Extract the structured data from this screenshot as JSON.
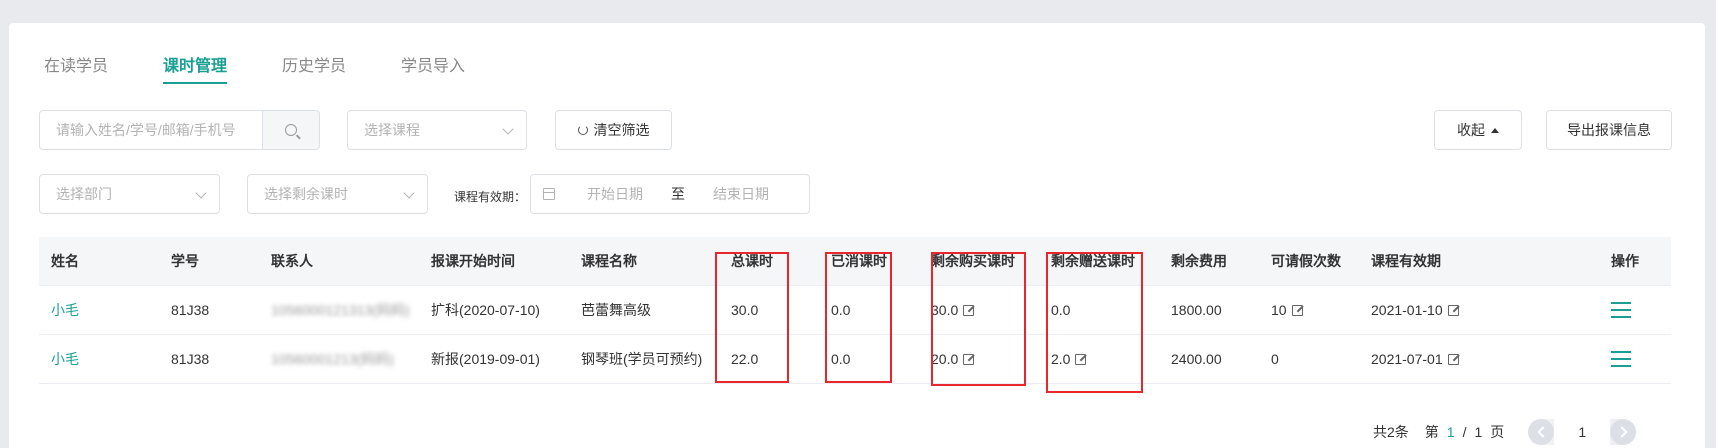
{
  "tabs": [
    {
      "label": "在读学员"
    },
    {
      "label": "课时管理"
    },
    {
      "label": "历史学员"
    },
    {
      "label": "学员导入"
    }
  ],
  "filters": {
    "search_placeholder": "请输入姓名/学号/邮箱/手机号",
    "course_placeholder": "选择课程",
    "clear_label": "清空筛选",
    "collapse_label": "收起",
    "export_label": "导出报课信息",
    "dept_placeholder": "选择部门",
    "remain_placeholder": "选择剩余课时",
    "validity_label": "课程有效期：",
    "start_date_placeholder": "开始日期",
    "date_sep": "至",
    "end_date_placeholder": "结束日期"
  },
  "table": {
    "headers": [
      "姓名",
      "学号",
      "联系人",
      "报课开始时间",
      "课程名称",
      "总课时",
      "已消课时",
      "剩余购买课时",
      "剩余赠送课时",
      "剩余费用",
      "可请假次数",
      "课程有效期",
      "操作"
    ],
    "rows": [
      {
        "name": "小毛",
        "id": "81J38",
        "contact": "1056000121313(妈妈)",
        "start": "扩科(2020-07-10)",
        "course": "芭蕾舞高级",
        "total": "30.0",
        "consumed": "0.0",
        "remain_buy": "30.0",
        "remain_gift": "0.0",
        "fee": "1800.00",
        "leave": "10",
        "validity": "2021-01-10"
      },
      {
        "name": "小毛",
        "id": "81J38",
        "contact": "10560001213(妈妈)",
        "start": "新报(2019-09-01)",
        "course": "钢琴班(学员可预约)",
        "total": "22.0",
        "consumed": "0.0",
        "remain_buy": "20.0",
        "remain_gift": "2.0",
        "fee": "2400.00",
        "leave": "0",
        "validity": "2021-07-01"
      }
    ]
  },
  "pagination": {
    "total_text": "共2条",
    "page_prefix": "第",
    "current": "1",
    "sep": "/",
    "total_pages": "1",
    "page_suffix": "页",
    "input_value": "1"
  },
  "colors": {
    "accent": "#1a9f95",
    "highlight": "#e8262b"
  }
}
